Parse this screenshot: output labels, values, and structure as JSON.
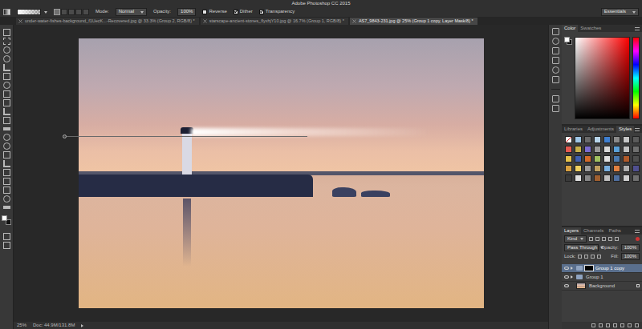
{
  "window": {
    "title": "Adobe Photoshop CC 2015",
    "workspace": "Essentials"
  },
  "options_bar": {
    "gradient_types": [
      {
        "selected": true
      },
      {
        "selected": false
      },
      {
        "selected": false
      },
      {
        "selected": false
      },
      {
        "selected": false
      }
    ],
    "mode_label": "Mode:",
    "mode": "Normal",
    "opacity_label": "Opacity:",
    "opacity": "100%",
    "checkboxes": [
      {
        "label": "Reverse",
        "checked": false
      },
      {
        "label": "Dither",
        "checked": true
      },
      {
        "label": "Transparency",
        "checked": true
      }
    ]
  },
  "document_tabs": [
    {
      "label": "under-water-fishes-background_f1UecK...-Recovered.jpg @ 33.3% (Group 2, RGB/8) *",
      "selected": false
    },
    {
      "label": "starscape-ancient-stones_flyxhjY10.jpg @ 16.7% (Group 1, RGB/8) *",
      "selected": false
    },
    {
      "label": "AS7_9843-231.jpg @ 25% (Group 1 copy, Layer Mask/8) *",
      "selected": true
    }
  ],
  "color_panel": {
    "tabs": [
      {
        "label": "Color",
        "selected": true
      },
      {
        "label": "Swatches",
        "selected": false
      }
    ]
  },
  "styles_panel": {
    "tabs": [
      {
        "label": "Libraries",
        "selected": false
      },
      {
        "label": "Adjustments",
        "selected": false
      },
      {
        "label": "Styles",
        "selected": true
      }
    ]
  },
  "layers_panel": {
    "tabs": [
      {
        "label": "Layers",
        "selected": true
      },
      {
        "label": "Channels",
        "selected": false
      },
      {
        "label": "Paths",
        "selected": false
      }
    ],
    "filter": "Kind",
    "blend_mode": "Pass Through",
    "opacity_label": "Opacity:",
    "opacity": "100%",
    "lock_label": "Lock:",
    "fill_label": "Fill:",
    "fill": "100%",
    "layers": [
      {
        "name": "Group 1 copy",
        "kind": "group",
        "visible": true,
        "expanded": false,
        "mask": true,
        "locked": false,
        "selected": true
      },
      {
        "name": "Group 1",
        "kind": "group",
        "visible": true,
        "expanded": false,
        "mask": false,
        "locked": false,
        "selected": false
      },
      {
        "name": "Background",
        "kind": "image",
        "visible": true,
        "mask": false,
        "locked": true,
        "selected": false
      }
    ]
  },
  "status_bar": {
    "zoom": "25%",
    "document_size": "Doc: 44.9M/131.8M"
  }
}
